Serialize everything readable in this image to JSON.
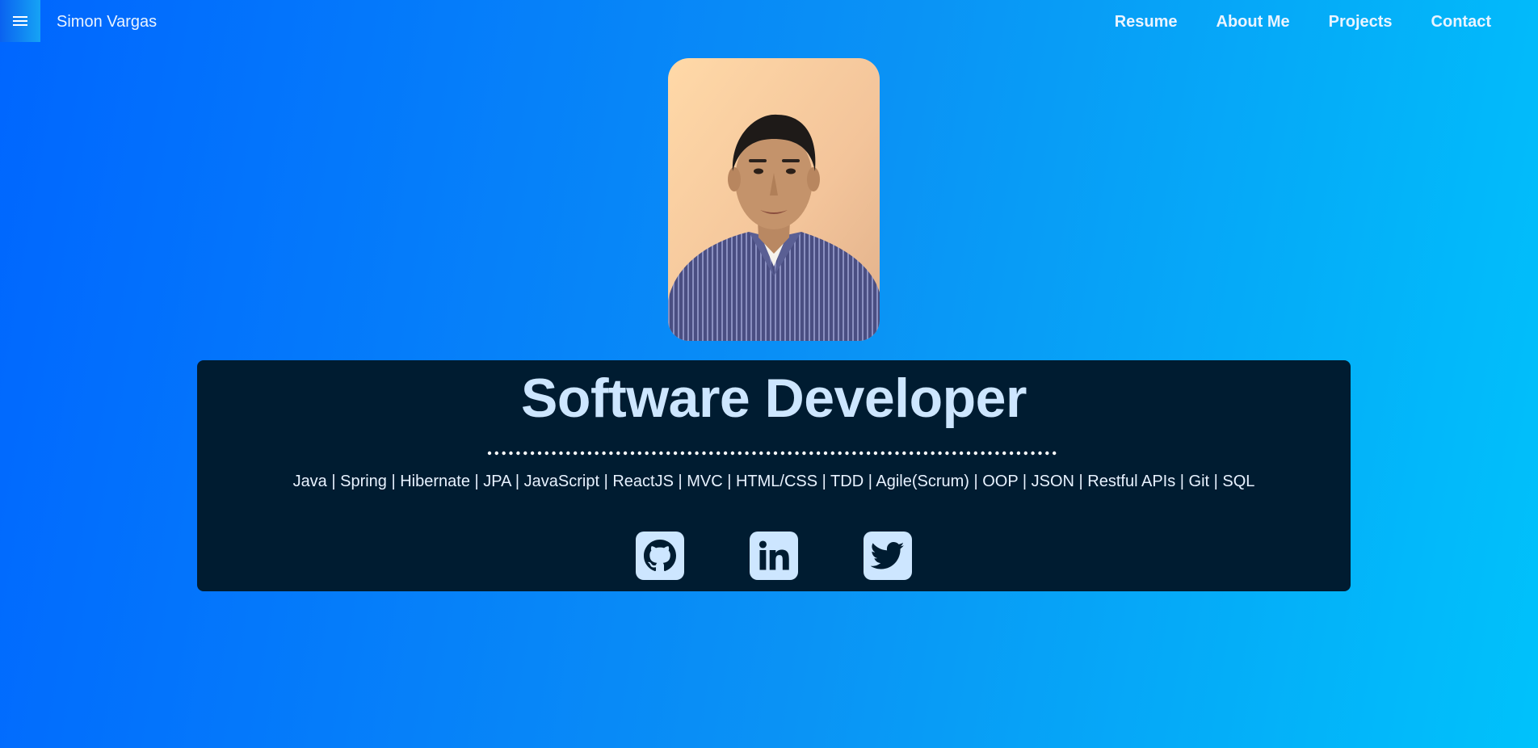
{
  "header": {
    "menu_icon": "hamburger-menu-icon",
    "brand": "Simon Vargas",
    "nav": [
      {
        "label": "Resume"
      },
      {
        "label": "About Me"
      },
      {
        "label": "Projects"
      },
      {
        "label": "Contact"
      }
    ]
  },
  "hero": {
    "photo_icon": "profile-photo",
    "title": "Software Developer",
    "skills": "Java | Spring | Hibernate | JPA | JavaScript | ReactJS | MVC | HTML/CSS | TDD | Agile(Scrum) | OOP | JSON | Restful APIs | Git | SQL",
    "social": [
      {
        "icon": "github-icon"
      },
      {
        "icon": "linkedin-icon"
      },
      {
        "icon": "twitter-icon"
      }
    ]
  },
  "colors": {
    "gradient_start": "#0066ff",
    "gradient_end": "#00c2fb",
    "card_bg": "#001c31",
    "accent_text": "#cde6ff"
  }
}
